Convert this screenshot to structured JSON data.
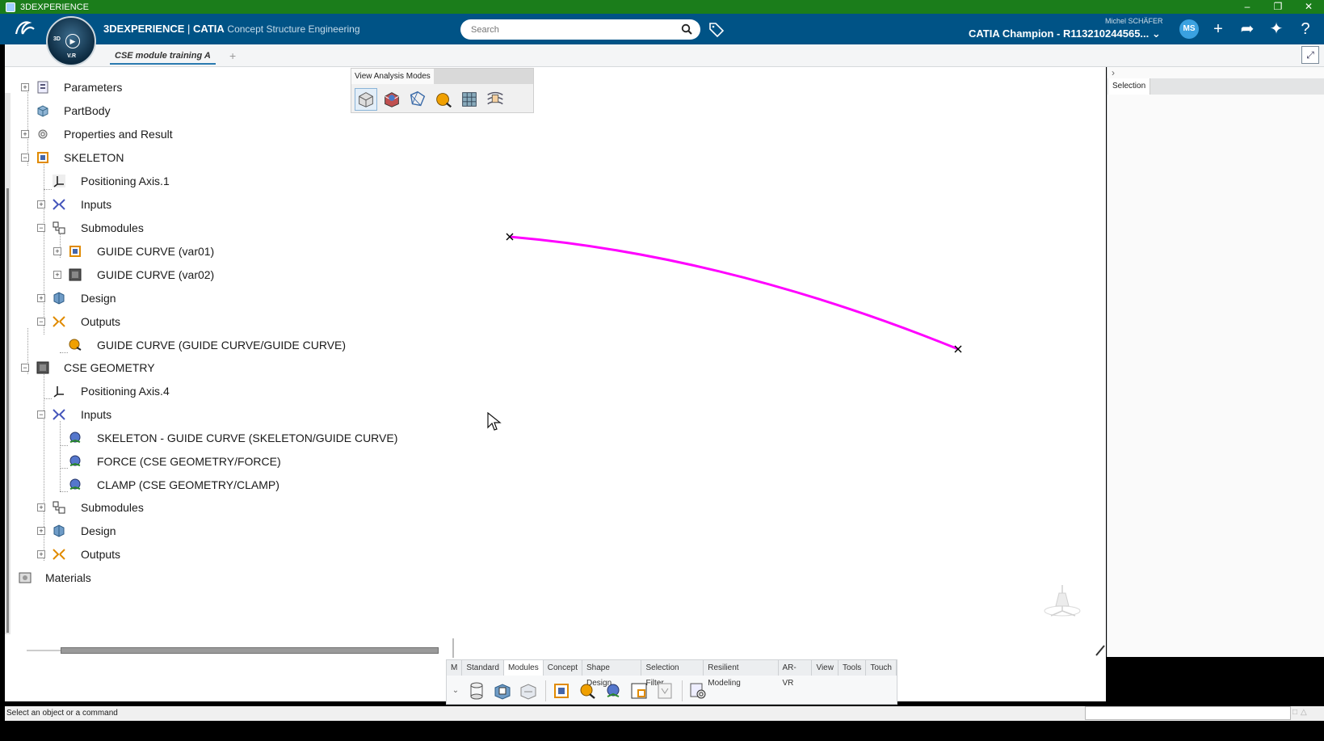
{
  "window": {
    "title": "3DEXPERIENCE"
  },
  "header": {
    "brand": "3DEXPERIENCE",
    "separator": " | ",
    "product": "CATIA",
    "role": "Concept Structure Engineering",
    "compass_3d": "3D",
    "compass_vr": "V.R",
    "search_placeholder": "Search",
    "user_name": "Michel SCHÄFER",
    "platform": "CATIA Champion - R113210244565...",
    "avatar_initials": "MS"
  },
  "tabs": [
    {
      "label": "CSE module training A"
    }
  ],
  "tree": [
    {
      "label": "Parameters",
      "icon": "parameters-icon"
    },
    {
      "label": "PartBody",
      "icon": "partbody-icon"
    },
    {
      "label": "Properties and Result",
      "icon": "properties-icon"
    },
    {
      "label": "SKELETON",
      "icon": "module-icon"
    },
    {
      "label": "Positioning Axis.1",
      "icon": "axis-icon"
    },
    {
      "label": "Inputs",
      "icon": "inputs-icon"
    },
    {
      "label": "Submodules",
      "icon": "submodules-icon"
    },
    {
      "label": "GUIDE CURVE (var01)",
      "icon": "module-icon"
    },
    {
      "label": "GUIDE CURVE (var02)",
      "icon": "module-dark-icon"
    },
    {
      "label": "Design",
      "icon": "design-icon"
    },
    {
      "label": "Outputs",
      "icon": "outputs-icon"
    },
    {
      "label": "GUIDE CURVE (GUIDE CURVE/GUIDE CURVE)",
      "icon": "output-publication-icon"
    },
    {
      "label": "CSE GEOMETRY",
      "icon": "module-dark-icon"
    },
    {
      "label": "Positioning Axis.4",
      "icon": "axis-icon"
    },
    {
      "label": "Inputs",
      "icon": "inputs-icon"
    },
    {
      "label": "SKELETON - GUIDE CURVE (SKELETON/GUIDE CURVE)",
      "icon": "input-publication-icon"
    },
    {
      "label": "FORCE (CSE GEOMETRY/FORCE)",
      "icon": "input-publication-icon"
    },
    {
      "label": "CLAMP (CSE GEOMETRY/CLAMP)",
      "icon": "input-publication-icon"
    },
    {
      "label": "Submodules",
      "icon": "submodules-icon"
    },
    {
      "label": "Design",
      "icon": "design-icon"
    },
    {
      "label": "Outputs",
      "icon": "outputs-icon"
    },
    {
      "label": "Materials",
      "icon": "materials-icon"
    }
  ],
  "view_analysis_modes": {
    "title": "View Analysis Modes",
    "buttons": [
      "shading-mode-icon",
      "material-mode-icon",
      "wireframe-mode-icon",
      "publication-mode-icon",
      "mesh-mode-icon",
      "analysis-mode-icon"
    ]
  },
  "right_panel": {
    "tab": "Selection"
  },
  "action_bar": {
    "tabs": [
      "M",
      "Standard",
      "Modules",
      "Concept",
      "Shape Design",
      "Selection Filter",
      "Resilient Modeling",
      "AR-VR",
      "View",
      "Tools",
      "Touch"
    ],
    "active_tab": "Modules"
  },
  "status": {
    "message": "Select an object or a command"
  },
  "colors": {
    "header": "#005386",
    "titlebar": "#1b7d1b",
    "curve": "#ff00ff"
  }
}
